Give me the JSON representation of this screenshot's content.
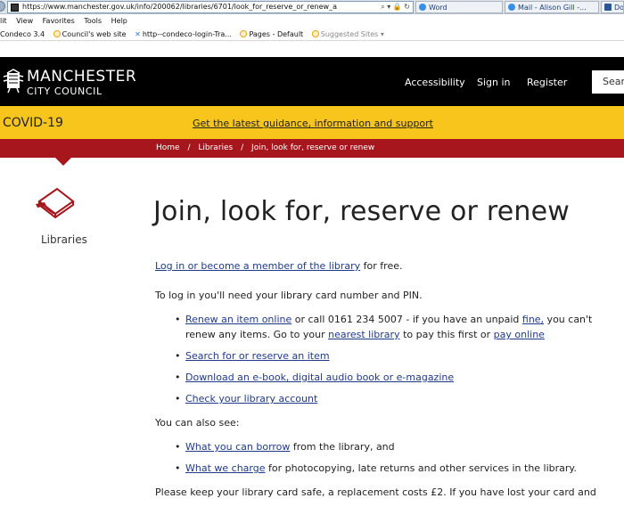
{
  "browser": {
    "url": "https://www.manchester.gov.uk/info/200062/libraries/6701/look_for_reserve_or_renew_a",
    "url_tools": "⌕ ▾ 🔒 ↻",
    "tabs": [
      {
        "label": "Word"
      },
      {
        "label": "Mail - Alison Gill -..."
      },
      {
        "label": "Do"
      }
    ],
    "menu": [
      "lit",
      "View",
      "Favorites",
      "Tools",
      "Help"
    ],
    "favorites": [
      {
        "label": "Condeco 3.4"
      },
      {
        "label": "Council's web site"
      },
      {
        "label": "http--condeco-login-Tra..."
      },
      {
        "label": "Pages - Default"
      },
      {
        "label": "Suggested Sites ▾"
      }
    ]
  },
  "header": {
    "brand_line1": "MANCHESTER",
    "brand_line2": "CITY COUNCIL",
    "nav": [
      {
        "label": "Accessibility"
      },
      {
        "label": "Sign in"
      },
      {
        "label": "Register"
      }
    ],
    "search_placeholder": "Searc"
  },
  "banner": {
    "title": "COVID-19",
    "link": "Get the latest guidance, information and support",
    "link_suffix": "."
  },
  "breadcrumb": [
    "Home",
    "Libraries",
    "Join, look for, reserve or renew"
  ],
  "breadcrumb_sep": "/",
  "section_label": "Libraries",
  "page": {
    "title": "Join, look for, reserve or renew",
    "intro_link": "Log in or become a member of the library",
    "intro_rest": " for free.",
    "login_note": "To log in you'll need your library card number and PIN.",
    "renew": {
      "link": "Renew an item online",
      "text1": " or call 0161 234 5007 - if you have an unpaid ",
      "fine_link": "fine,",
      "text2": " you can't renew any items. Go to your ",
      "nearest_link": "nearest library",
      "text3": " to pay this first or ",
      "pay_link": "pay online"
    },
    "links": [
      "Search for or reserve an item",
      "Download an e-book, digital audio book or e-magazine",
      "Check your library account"
    ],
    "also_see": "You can also see:",
    "borrow_link": "What you can borrow",
    "borrow_rest": " from the library, and",
    "charge_link": "What we charge",
    "charge_rest": " for photocopying, late returns and other services in the library.",
    "footer_note": "Please keep your library card safe, a replacement costs £2. If you have lost your card and"
  }
}
